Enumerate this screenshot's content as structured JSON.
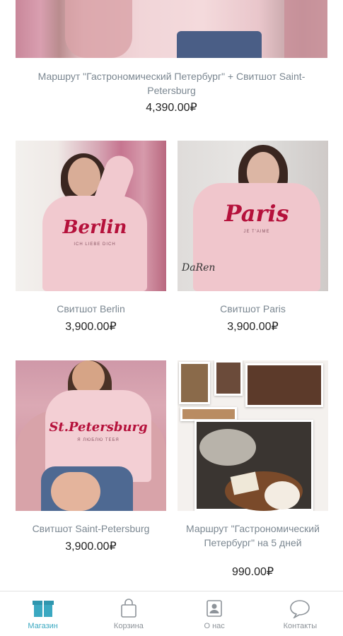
{
  "products": [
    {
      "title": "Маршрут \"Гастрономический Петербург\" + Свитшот Saint-Petersburg",
      "price": "4,390.00₽"
    },
    {
      "title": "Свитшот Berlin",
      "price": "3,900.00₽",
      "print": "Berlin",
      "print_sub": "ICH LIEBE DICH"
    },
    {
      "title": "Свитшот Paris",
      "price": "3,900.00₽",
      "print": "Paris",
      "print_sub": "JE T'AIME",
      "logo": "DaRen"
    },
    {
      "title": "Свитшот Saint-Petersburg",
      "price": "3,900.00₽",
      "print": "St.Petersburg",
      "print_sub": "Я ЛЮБЛЮ ТЕБЯ"
    },
    {
      "title": "Маршрут \"Гастрономический Петербург\" на 5 дней",
      "price": "990.00₽"
    }
  ],
  "tabs": [
    {
      "label": "Магазин",
      "icon": "shop-icon",
      "active": true
    },
    {
      "label": "Корзина",
      "icon": "cart-icon",
      "active": false
    },
    {
      "label": "О нас",
      "icon": "about-icon",
      "active": false
    },
    {
      "label": "Контакты",
      "icon": "contacts-icon",
      "active": false
    }
  ],
  "colors": {
    "accent": "#3aa8c1",
    "title_text": "#7b8791",
    "price_text": "#222222",
    "tab_inactive": "#8d9399"
  }
}
